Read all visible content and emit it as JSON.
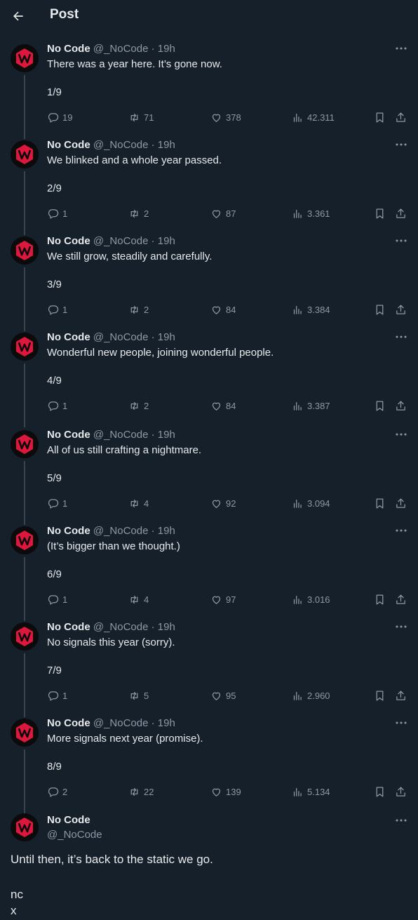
{
  "header": {
    "title": "Post",
    "back_icon": "arrow-left-icon"
  },
  "author": {
    "name": "No Code",
    "handle": "@_NoCode",
    "time": "19h",
    "dot": "·"
  },
  "tweets": [
    {
      "text": "There was a year here. It’s gone now.",
      "count": "1/9",
      "replies": "19",
      "reposts": "71",
      "likes": "378",
      "views": "42.311"
    },
    {
      "text": "We blinked and a whole year passed.",
      "count": "2/9",
      "replies": "1",
      "reposts": "2",
      "likes": "87",
      "views": "3.361"
    },
    {
      "text": "We still grow, steadily and carefully.",
      "count": "3/9",
      "replies": "1",
      "reposts": "2",
      "likes": "84",
      "views": "3.384"
    },
    {
      "text": "Wonderful new people, joining wonderful people.",
      "count": "4/9",
      "replies": "1",
      "reposts": "2",
      "likes": "84",
      "views": "3.387"
    },
    {
      "text": "All of us still crafting a nightmare.",
      "count": "5/9",
      "replies": "1",
      "reposts": "4",
      "likes": "92",
      "views": "3.094"
    },
    {
      "text": "(It’s bigger than we thought.)",
      "count": "6/9",
      "replies": "1",
      "reposts": "4",
      "likes": "97",
      "views": "3.016"
    },
    {
      "text": "No signals this year (sorry).",
      "count": "7/9",
      "replies": "1",
      "reposts": "5",
      "likes": "95",
      "views": "2.960"
    },
    {
      "text": "More signals next year (promise).",
      "count": "8/9",
      "replies": "2",
      "reposts": "22",
      "likes": "139",
      "views": "5.134"
    }
  ],
  "final": {
    "name": "No Code",
    "handle": "@_NoCode",
    "text": "Until then, it’s back to the static we go.",
    "line2": "nc",
    "line3": "x"
  },
  "colors": {
    "background": "#15202b",
    "text": "#e7e9ea",
    "muted": "#8b98a5",
    "thread_line": "#38444d",
    "logo_red": "#e0173c"
  }
}
